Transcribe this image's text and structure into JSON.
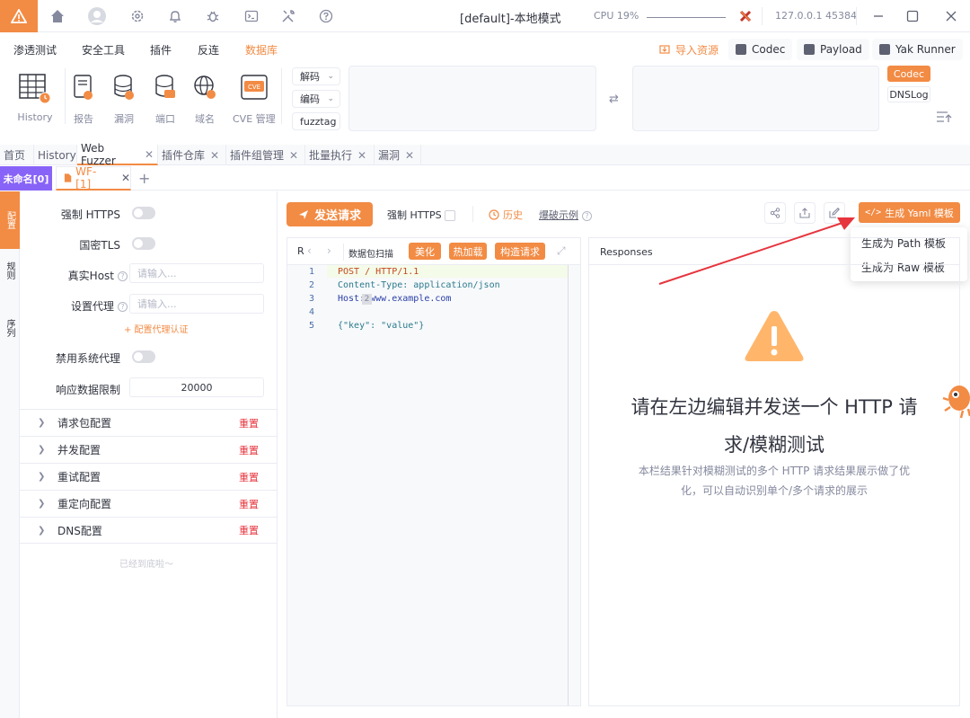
{
  "titlebar": {
    "title": "[default]-本地模式",
    "cpu_label": "CPU 19%",
    "address": "127.0.0.1 45384"
  },
  "menu": {
    "items": [
      "渗透测试",
      "安全工具",
      "插件",
      "反连",
      "数据库"
    ],
    "active": "数据库",
    "import_label": "导入资源",
    "codec_label": "Codec",
    "payload_label": "Payload",
    "yak_runner_label": "Yak Runner"
  },
  "toolbar": {
    "tools": [
      {
        "label": "History",
        "icon": "history-table-icon"
      },
      {
        "label": "报告",
        "icon": "report-icon"
      },
      {
        "label": "漏洞",
        "icon": "vulnerability-db-icon"
      },
      {
        "label": "端口",
        "icon": "port-db-icon"
      },
      {
        "label": "域名",
        "icon": "domain-globe-icon"
      },
      {
        "label": "CVE 管理",
        "icon": "cve-icon"
      }
    ],
    "decode_label": "解码",
    "encode_label": "编码",
    "fuzztag_label": "fuzztag",
    "codec_tag": "Codec",
    "dnslog_tag": "DNSLog"
  },
  "tabs": {
    "main": [
      {
        "label": "首页",
        "closable": false
      },
      {
        "label": "History",
        "closable": false
      },
      {
        "label": "Web Fuzzer",
        "closable": true,
        "active": true
      },
      {
        "label": "插件仓库",
        "closable": true
      },
      {
        "label": "插件组管理",
        "closable": true
      },
      {
        "label": "批量执行",
        "closable": true
      },
      {
        "label": "漏洞",
        "closable": true
      }
    ],
    "sub": [
      {
        "label": "未命名[0]"
      },
      {
        "label": "WF-[1]"
      }
    ]
  },
  "rail": {
    "items": [
      "配置",
      "规则",
      "序列"
    ]
  },
  "settings": {
    "force_https": "强制 HTTPS",
    "gm_tls": "国密TLS",
    "real_host": "真实Host",
    "real_host_placeholder": "请输入...",
    "proxy": "设置代理",
    "proxy_placeholder": "请输入...",
    "proxy_auth": "+ 配置代理认证",
    "disable_sys_proxy": "禁用系统代理",
    "resp_limit": "响应数据限制",
    "resp_limit_value": "20000",
    "groups": [
      "请求包配置",
      "并发配置",
      "重试配置",
      "重定向配置",
      "DNS配置"
    ],
    "reset_label": "重置",
    "end_text": "已经到底啦～"
  },
  "center": {
    "send_label": "发送请求",
    "force_https": "强制 HTTPS",
    "history_label": "历史",
    "example_label": "爆破示例",
    "yaml_label": "生成 Yaml 模板",
    "dropdown": [
      "生成为 Path 模板",
      "生成为 Raw 模板"
    ],
    "editor": {
      "head_first": "R",
      "scan_label": "数据包扫描",
      "beautify": "美化",
      "hot_patch": "热加载",
      "build_request": "构造请求",
      "lines": [
        {
          "n": "1",
          "text": "POST / HTTP/1.1"
        },
        {
          "n": "2",
          "text": "Content-Type: application/json"
        },
        {
          "n": "3",
          "text": "Host: www.example.com"
        },
        {
          "n": "4",
          "text": ""
        },
        {
          "n": "5",
          "text": "{\"key\": \"value\"}"
        }
      ],
      "host_badge": "2"
    },
    "responses": {
      "title": "Responses",
      "empty_title_1": "请在左边编辑并发送一个 HTTP 请",
      "empty_title_2": "求/模糊测试",
      "empty_desc_1": "本栏结果针对模糊测试的多个 HTTP 请求结果展示做了优",
      "empty_desc_2": "化，可以自动识别单个/多个请求的展示"
    }
  },
  "colors": {
    "accent": "#f28b44",
    "purple": "#8863f7",
    "danger": "#e6353e",
    "arrow": "#e6353e"
  }
}
